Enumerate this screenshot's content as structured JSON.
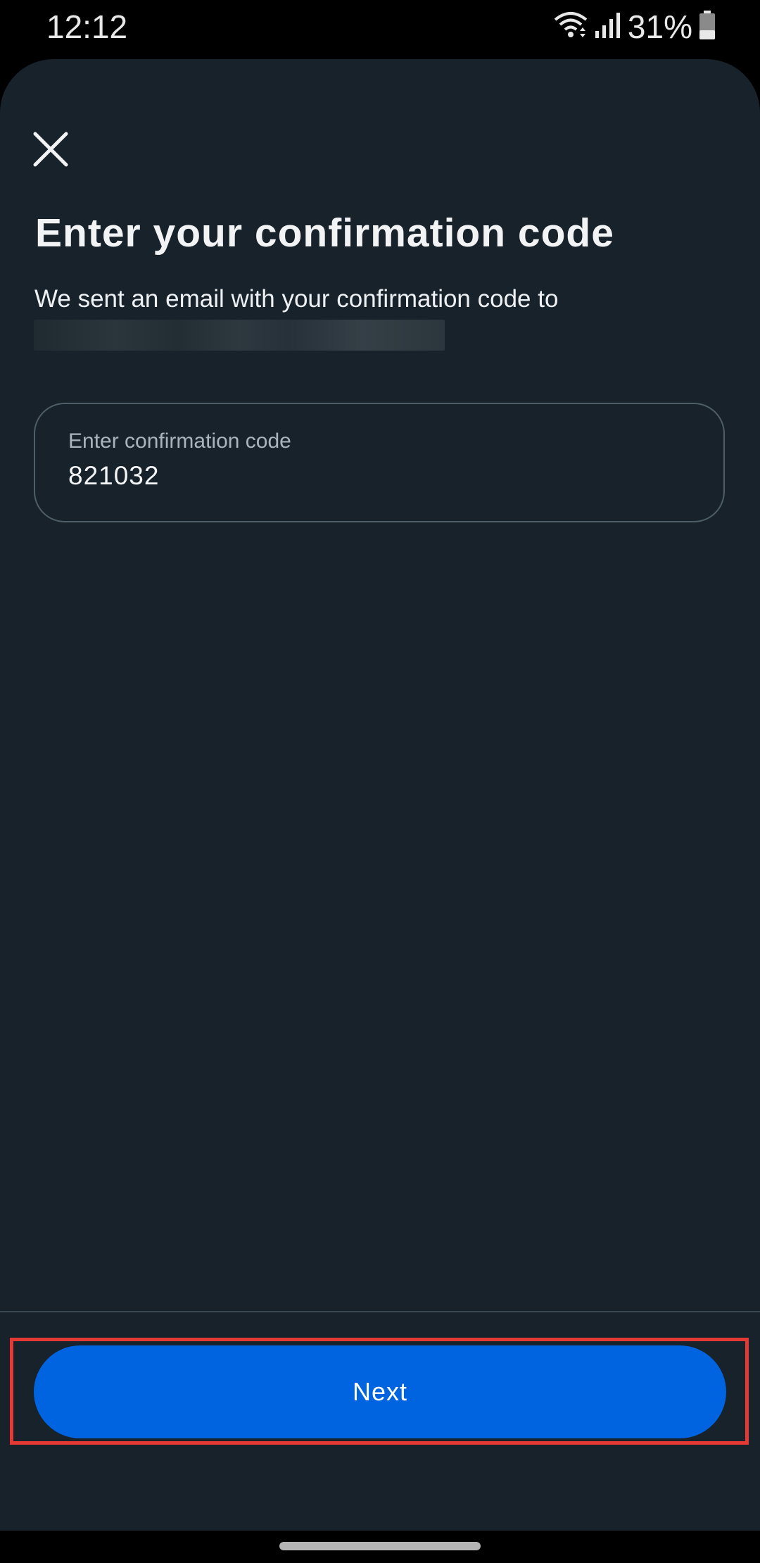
{
  "status_bar": {
    "time": "12:12",
    "battery_percent": "31%",
    "icons": [
      "wifi-icon",
      "signal-icon",
      "battery-icon"
    ]
  },
  "dialog": {
    "close_icon": "close-icon",
    "title": "Enter your confirmation code",
    "subtitle": "We sent an email with your confirmation code to",
    "email_redacted": true
  },
  "code_input": {
    "label": "Enter confirmation code",
    "value": "821032"
  },
  "footer": {
    "next_label": "Next"
  },
  "colors": {
    "sheet_background": "#18222a",
    "primary_button": "#0064e0",
    "highlight_border": "#e53935"
  }
}
